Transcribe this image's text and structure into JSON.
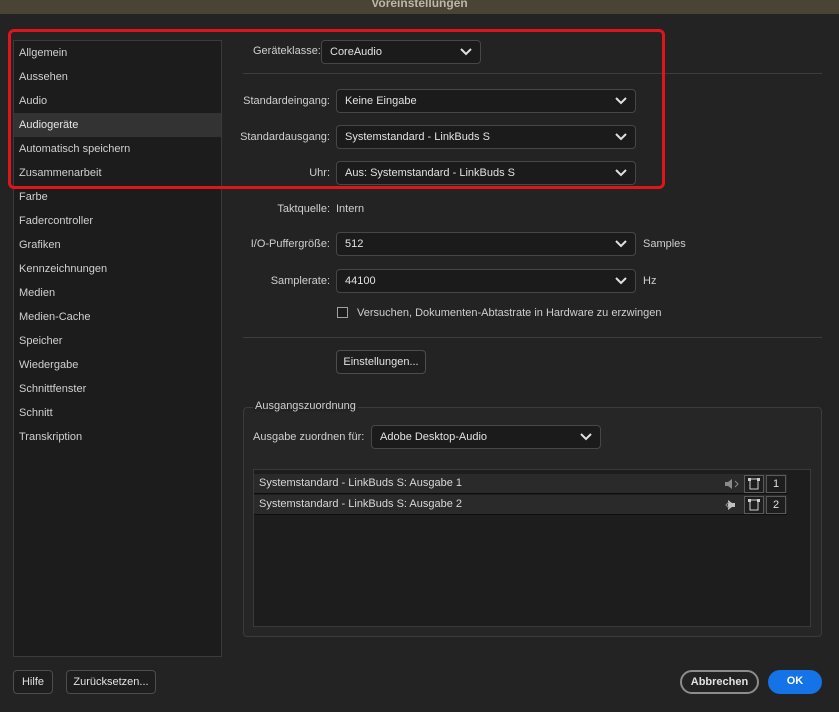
{
  "window": {
    "title": "Voreinstellungen"
  },
  "sidebar": {
    "items": [
      {
        "label": "Allgemein"
      },
      {
        "label": "Aussehen"
      },
      {
        "label": "Audio"
      },
      {
        "label": "Audiogeräte",
        "active": true
      },
      {
        "label": "Automatisch speichern"
      },
      {
        "label": "Zusammenarbeit"
      },
      {
        "label": "Farbe"
      },
      {
        "label": "Fadercontroller"
      },
      {
        "label": "Grafiken"
      },
      {
        "label": "Kennzeichnungen"
      },
      {
        "label": "Medien"
      },
      {
        "label": "Medien-Cache"
      },
      {
        "label": "Speicher"
      },
      {
        "label": "Wiedergabe"
      },
      {
        "label": "Schnittfenster"
      },
      {
        "label": "Schnitt"
      },
      {
        "label": "Transkription"
      }
    ]
  },
  "settings": {
    "device_class_label": "Geräteklasse:",
    "device_class_value": "CoreAudio",
    "default_input_label": "Standardeingang:",
    "default_input_value": "Keine Eingabe",
    "default_output_label": "Standardausgang:",
    "default_output_value": "Systemstandard - LinkBuds S",
    "clock_label": "Uhr:",
    "clock_value": "Aus: Systemstandard - LinkBuds S",
    "clock_source_label": "Taktquelle:",
    "clock_source_value": "Intern",
    "buffer_label": "I/O-Puffergröße:",
    "buffer_value": "512",
    "buffer_unit": "Samples",
    "samplerate_label": "Samplerate:",
    "samplerate_value": "44100",
    "samplerate_unit": "Hz",
    "force_rate_label": "Versuchen, Dokumenten-Abtastrate in Hardware zu erzwingen",
    "force_rate_checked": false,
    "settings_button": "Einstellungen..."
  },
  "output_mapping": {
    "legend": "Ausgangszuordnung",
    "map_label": "Ausgabe zuordnen für:",
    "map_value": "Adobe Desktop-Audio",
    "rows": [
      {
        "name": "Systemstandard - LinkBuds S: Ausgabe 1",
        "channel": "1"
      },
      {
        "name": "Systemstandard - LinkBuds S: Ausgabe 2",
        "channel": "2"
      }
    ]
  },
  "footer": {
    "help": "Hilfe",
    "reset": "Zurücksetzen...",
    "cancel": "Abbrechen",
    "ok": "OK"
  },
  "colors": {
    "accent": "#1473e6",
    "highlight": "#e0141b"
  }
}
